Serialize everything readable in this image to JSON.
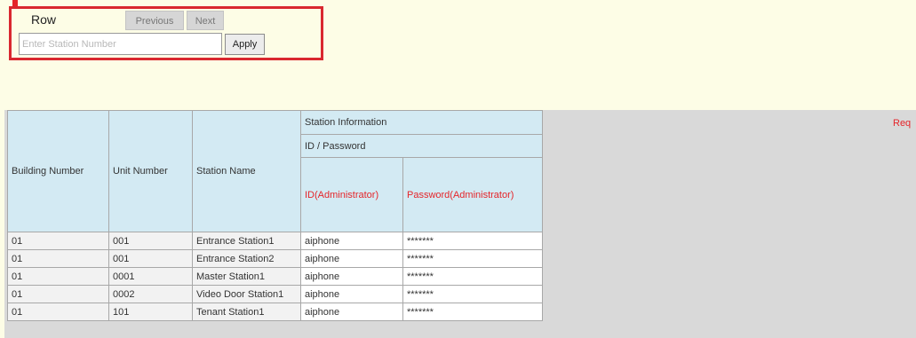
{
  "controls": {
    "row_label": "Row",
    "previous_label": "Previous",
    "next_label": "Next",
    "station_input_placeholder": "Enter Station Number",
    "station_input_value": "",
    "apply_label": "Apply"
  },
  "table": {
    "headers": {
      "building_number": "Building Number",
      "unit_number": "Unit Number",
      "station_name": "Station Name",
      "station_information": "Station Information",
      "id_password": "ID / Password",
      "id_admin": "ID(Administrator)",
      "password_admin": "Password(Administrator)"
    },
    "rows": [
      {
        "building": "01",
        "unit": "001",
        "name": "Entrance Station1",
        "id": "aiphone",
        "password": "*******"
      },
      {
        "building": "01",
        "unit": "001",
        "name": "Entrance Station2",
        "id": "aiphone",
        "password": "*******"
      },
      {
        "building": "01",
        "unit": "0001",
        "name": "Master Station1",
        "id": "aiphone",
        "password": "*******"
      },
      {
        "building": "01",
        "unit": "0002",
        "name": "Video Door Station1",
        "id": "aiphone",
        "password": "*******"
      },
      {
        "building": "01",
        "unit": "101",
        "name": "Tenant Station1",
        "id": "aiphone",
        "password": "*******"
      }
    ]
  },
  "side_note": "Req",
  "colors": {
    "header_bg": "#d3eaf3",
    "accent_red": "#e5252a",
    "page_bg": "#fdfde6"
  }
}
